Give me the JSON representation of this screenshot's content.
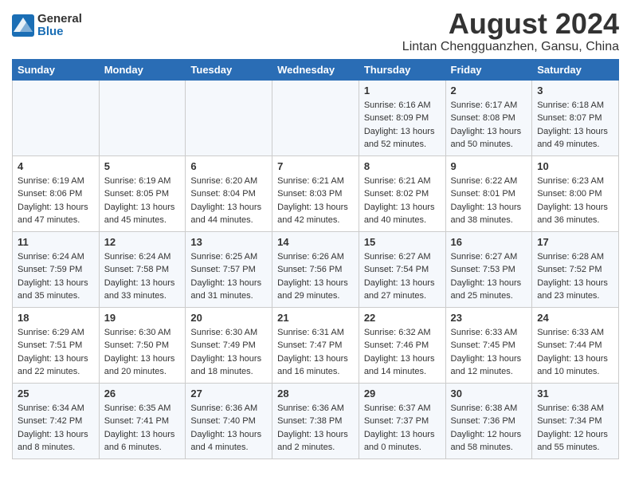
{
  "header": {
    "logo_general": "General",
    "logo_blue": "Blue",
    "month": "August 2024",
    "location": "Lintan Chengguanzhen, Gansu, China"
  },
  "days_of_week": [
    "Sunday",
    "Monday",
    "Tuesday",
    "Wednesday",
    "Thursday",
    "Friday",
    "Saturday"
  ],
  "weeks": [
    [
      {
        "day": "",
        "info": ""
      },
      {
        "day": "",
        "info": ""
      },
      {
        "day": "",
        "info": ""
      },
      {
        "day": "",
        "info": ""
      },
      {
        "day": "1",
        "info": "Sunrise: 6:16 AM\nSunset: 8:09 PM\nDaylight: 13 hours\nand 52 minutes."
      },
      {
        "day": "2",
        "info": "Sunrise: 6:17 AM\nSunset: 8:08 PM\nDaylight: 13 hours\nand 50 minutes."
      },
      {
        "day": "3",
        "info": "Sunrise: 6:18 AM\nSunset: 8:07 PM\nDaylight: 13 hours\nand 49 minutes."
      }
    ],
    [
      {
        "day": "4",
        "info": "Sunrise: 6:19 AM\nSunset: 8:06 PM\nDaylight: 13 hours\nand 47 minutes."
      },
      {
        "day": "5",
        "info": "Sunrise: 6:19 AM\nSunset: 8:05 PM\nDaylight: 13 hours\nand 45 minutes."
      },
      {
        "day": "6",
        "info": "Sunrise: 6:20 AM\nSunset: 8:04 PM\nDaylight: 13 hours\nand 44 minutes."
      },
      {
        "day": "7",
        "info": "Sunrise: 6:21 AM\nSunset: 8:03 PM\nDaylight: 13 hours\nand 42 minutes."
      },
      {
        "day": "8",
        "info": "Sunrise: 6:21 AM\nSunset: 8:02 PM\nDaylight: 13 hours\nand 40 minutes."
      },
      {
        "day": "9",
        "info": "Sunrise: 6:22 AM\nSunset: 8:01 PM\nDaylight: 13 hours\nand 38 minutes."
      },
      {
        "day": "10",
        "info": "Sunrise: 6:23 AM\nSunset: 8:00 PM\nDaylight: 13 hours\nand 36 minutes."
      }
    ],
    [
      {
        "day": "11",
        "info": "Sunrise: 6:24 AM\nSunset: 7:59 PM\nDaylight: 13 hours\nand 35 minutes."
      },
      {
        "day": "12",
        "info": "Sunrise: 6:24 AM\nSunset: 7:58 PM\nDaylight: 13 hours\nand 33 minutes."
      },
      {
        "day": "13",
        "info": "Sunrise: 6:25 AM\nSunset: 7:57 PM\nDaylight: 13 hours\nand 31 minutes."
      },
      {
        "day": "14",
        "info": "Sunrise: 6:26 AM\nSunset: 7:56 PM\nDaylight: 13 hours\nand 29 minutes."
      },
      {
        "day": "15",
        "info": "Sunrise: 6:27 AM\nSunset: 7:54 PM\nDaylight: 13 hours\nand 27 minutes."
      },
      {
        "day": "16",
        "info": "Sunrise: 6:27 AM\nSunset: 7:53 PM\nDaylight: 13 hours\nand 25 minutes."
      },
      {
        "day": "17",
        "info": "Sunrise: 6:28 AM\nSunset: 7:52 PM\nDaylight: 13 hours\nand 23 minutes."
      }
    ],
    [
      {
        "day": "18",
        "info": "Sunrise: 6:29 AM\nSunset: 7:51 PM\nDaylight: 13 hours\nand 22 minutes."
      },
      {
        "day": "19",
        "info": "Sunrise: 6:30 AM\nSunset: 7:50 PM\nDaylight: 13 hours\nand 20 minutes."
      },
      {
        "day": "20",
        "info": "Sunrise: 6:30 AM\nSunset: 7:49 PM\nDaylight: 13 hours\nand 18 minutes."
      },
      {
        "day": "21",
        "info": "Sunrise: 6:31 AM\nSunset: 7:47 PM\nDaylight: 13 hours\nand 16 minutes."
      },
      {
        "day": "22",
        "info": "Sunrise: 6:32 AM\nSunset: 7:46 PM\nDaylight: 13 hours\nand 14 minutes."
      },
      {
        "day": "23",
        "info": "Sunrise: 6:33 AM\nSunset: 7:45 PM\nDaylight: 13 hours\nand 12 minutes."
      },
      {
        "day": "24",
        "info": "Sunrise: 6:33 AM\nSunset: 7:44 PM\nDaylight: 13 hours\nand 10 minutes."
      }
    ],
    [
      {
        "day": "25",
        "info": "Sunrise: 6:34 AM\nSunset: 7:42 PM\nDaylight: 13 hours\nand 8 minutes."
      },
      {
        "day": "26",
        "info": "Sunrise: 6:35 AM\nSunset: 7:41 PM\nDaylight: 13 hours\nand 6 minutes."
      },
      {
        "day": "27",
        "info": "Sunrise: 6:36 AM\nSunset: 7:40 PM\nDaylight: 13 hours\nand 4 minutes."
      },
      {
        "day": "28",
        "info": "Sunrise: 6:36 AM\nSunset: 7:38 PM\nDaylight: 13 hours\nand 2 minutes."
      },
      {
        "day": "29",
        "info": "Sunrise: 6:37 AM\nSunset: 7:37 PM\nDaylight: 13 hours\nand 0 minutes."
      },
      {
        "day": "30",
        "info": "Sunrise: 6:38 AM\nSunset: 7:36 PM\nDaylight: 12 hours\nand 58 minutes."
      },
      {
        "day": "31",
        "info": "Sunrise: 6:38 AM\nSunset: 7:34 PM\nDaylight: 12 hours\nand 55 minutes."
      }
    ]
  ]
}
